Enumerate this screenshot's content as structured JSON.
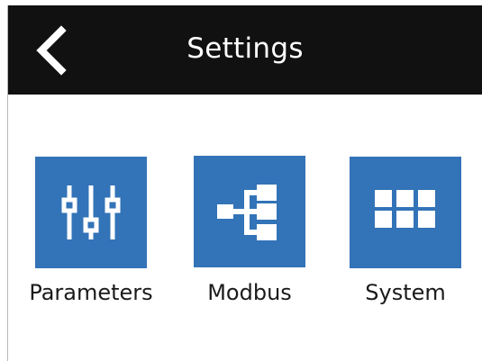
{
  "header": {
    "title": "Settings",
    "back_icon": "chevron-left-icon",
    "background": "#111111"
  },
  "tiles": [
    {
      "label": "Parameters",
      "icon": "sliders-icon"
    },
    {
      "label": "Modbus",
      "icon": "network-tree-icon"
    },
    {
      "label": "System",
      "icon": "grid-icon"
    }
  ],
  "colors": {
    "accent": "#3373b7",
    "header_text": "#ffffff",
    "label_text": "#1a1a1a"
  }
}
